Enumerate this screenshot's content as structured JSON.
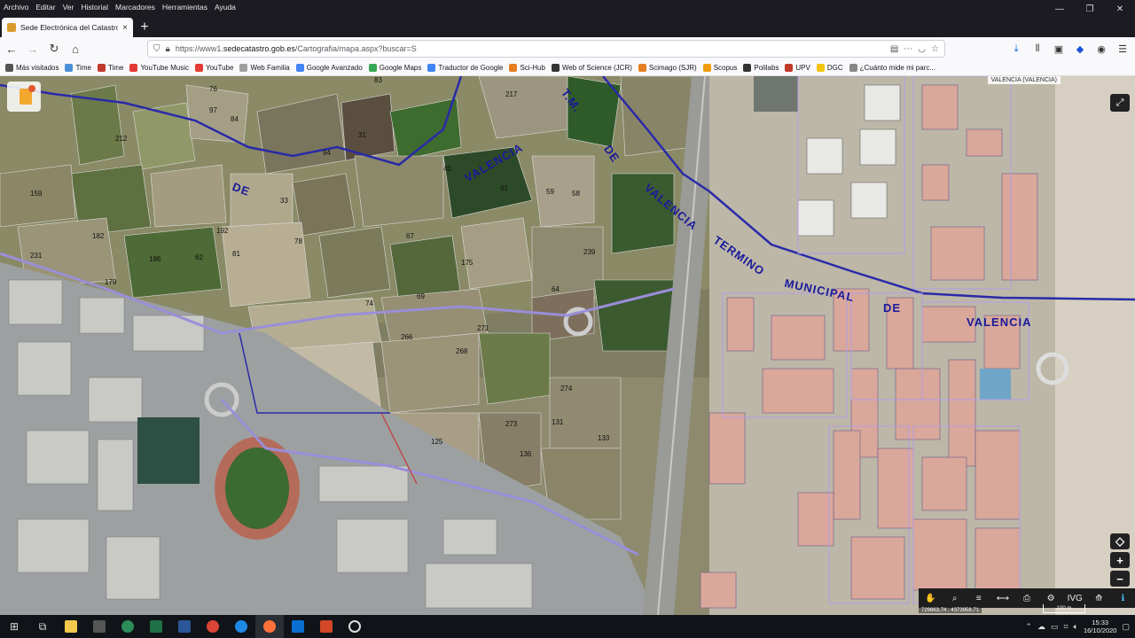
{
  "menu": {
    "items": [
      "Archivo",
      "Editar",
      "Ver",
      "Historial",
      "Marcadores",
      "Herramientas",
      "Ayuda"
    ]
  },
  "tab": {
    "title": "Sede Electrónica del Catastro",
    "close": "×",
    "new": "+"
  },
  "nav": {
    "back": "←",
    "forward": "→",
    "reload": "↻",
    "home": "⌂"
  },
  "url": {
    "prefix": "https://www1.",
    "host": "sedecatastro.gob.es",
    "path": "/Cartografia/mapa.aspx?buscar=S"
  },
  "bookmarks": [
    {
      "label": "Más visitados",
      "color": "#555555"
    },
    {
      "label": "Time",
      "color": "#4a90d9"
    },
    {
      "label": "Time",
      "color": "#c0392b"
    },
    {
      "label": "YouTube Music",
      "color": "#e53935"
    },
    {
      "label": "YouTube",
      "color": "#e53935"
    },
    {
      "label": "Web Familia",
      "color": "#9e9e9e"
    },
    {
      "label": "Google Avanzado",
      "color": "#4285f4"
    },
    {
      "label": "Google Maps",
      "color": "#34a853"
    },
    {
      "label": "Traductor de Google",
      "color": "#4285f4"
    },
    {
      "label": "Sci-Hub",
      "color": "#e67e22"
    },
    {
      "label": "Web of Science (JCR)",
      "color": "#333333"
    },
    {
      "label": "Scimago (SJR)",
      "color": "#e67e22"
    },
    {
      "label": "Scopus",
      "color": "#f39c12"
    },
    {
      "label": "Polilabs",
      "color": "#333333"
    },
    {
      "label": "UPV",
      "color": "#c0392b"
    },
    {
      "label": "DGC",
      "color": "#f1c40f"
    },
    {
      "label": "¿Cuánto mide mi parc...",
      "color": "#888888"
    }
  ],
  "map": {
    "location": "VALENCIA (VALENCIA)",
    "labels": {
      "tm": "T.M.",
      "de1": "DE",
      "valencia1": "VALENCIA",
      "de2": "DE",
      "valencia2": "VALENCIA",
      "termino": "TERMINO",
      "municipal": "MUNICIPAL",
      "de3": "DE",
      "valencia3": "VALENCIA"
    },
    "parcels": [
      "83",
      "217",
      "76",
      "97",
      "212",
      "31",
      "40",
      "58",
      "59",
      "41",
      "33",
      "159",
      "182",
      "192",
      "62",
      "67",
      "175",
      "81",
      "78",
      "64",
      "239",
      "74",
      "69",
      "266",
      "271",
      "268",
      "274",
      "131",
      "133",
      "125",
      "273",
      "136",
      "179",
      "186",
      "231",
      "84",
      "94"
    ],
    "coords": "729863,74 , 4373958,71",
    "scale": "100 m"
  },
  "toolbar": {
    "tools": [
      "✋",
      "⌕",
      "≡",
      "⟷",
      "⎙",
      "⚙",
      "IVG",
      "⟰",
      "ℹ"
    ]
  },
  "controls": {
    "fullscreen": "⤢",
    "locate": "◇",
    "zoom_in": "+",
    "zoom_out": "−"
  },
  "taskbar": {
    "start": "⊞",
    "time": "15:33",
    "date": "16/10/2020"
  }
}
